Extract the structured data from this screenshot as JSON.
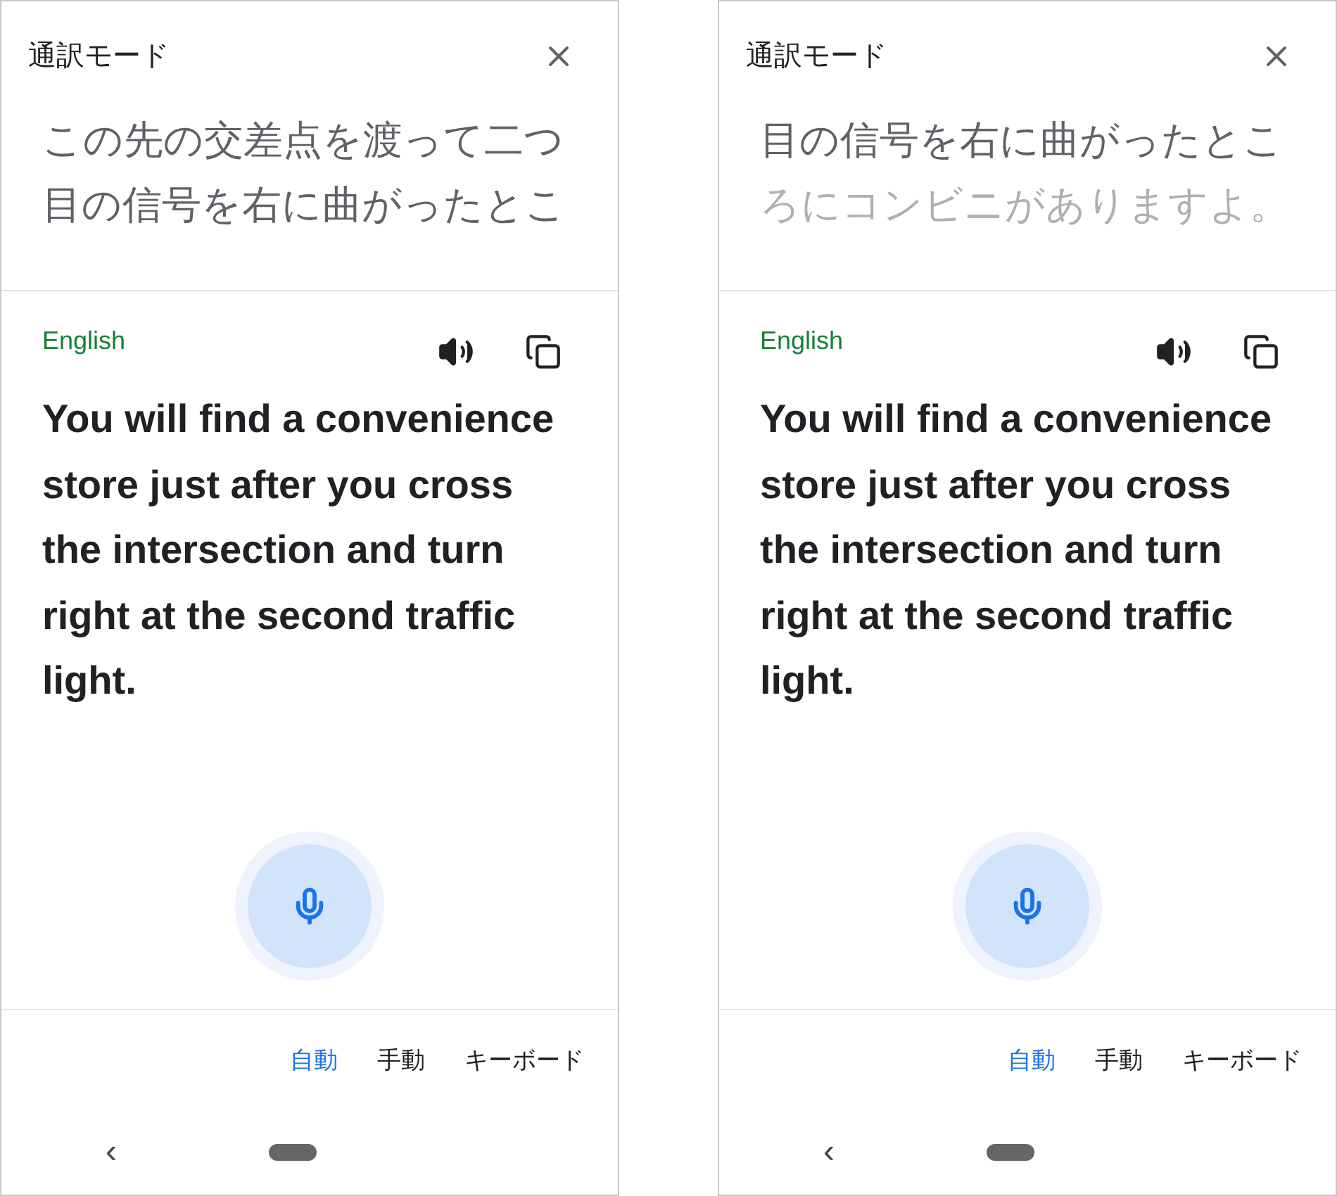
{
  "screens": [
    {
      "title": "通訳モード",
      "source_lines": [
        {
          "text": "この先の交差点を渡って二つ",
          "faded": false
        },
        {
          "text": "目の信号を右に曲がったとこ",
          "faded": false
        }
      ],
      "language": "English",
      "translation": "You will find a convenience store just after you cross the intersection and turn right at the second traffic light.",
      "mode_tabs": [
        {
          "label": "自動",
          "selected": true
        },
        {
          "label": "手動",
          "selected": false
        },
        {
          "label": "キーボード",
          "selected": false
        }
      ],
      "back": "‹"
    },
    {
      "title": "通訳モード",
      "source_lines": [
        {
          "text": "目の信号を右に曲がったとこ",
          "faded": false
        },
        {
          "text": "ろにコンビニがありますよ。",
          "faded": true
        }
      ],
      "language": "English",
      "translation": "You will find a convenience store just after you cross the intersection and turn right at the second traffic light.",
      "mode_tabs": [
        {
          "label": "自動",
          "selected": true
        },
        {
          "label": "手動",
          "selected": false
        },
        {
          "label": "キーボード",
          "selected": false
        }
      ],
      "back": "‹"
    }
  ]
}
